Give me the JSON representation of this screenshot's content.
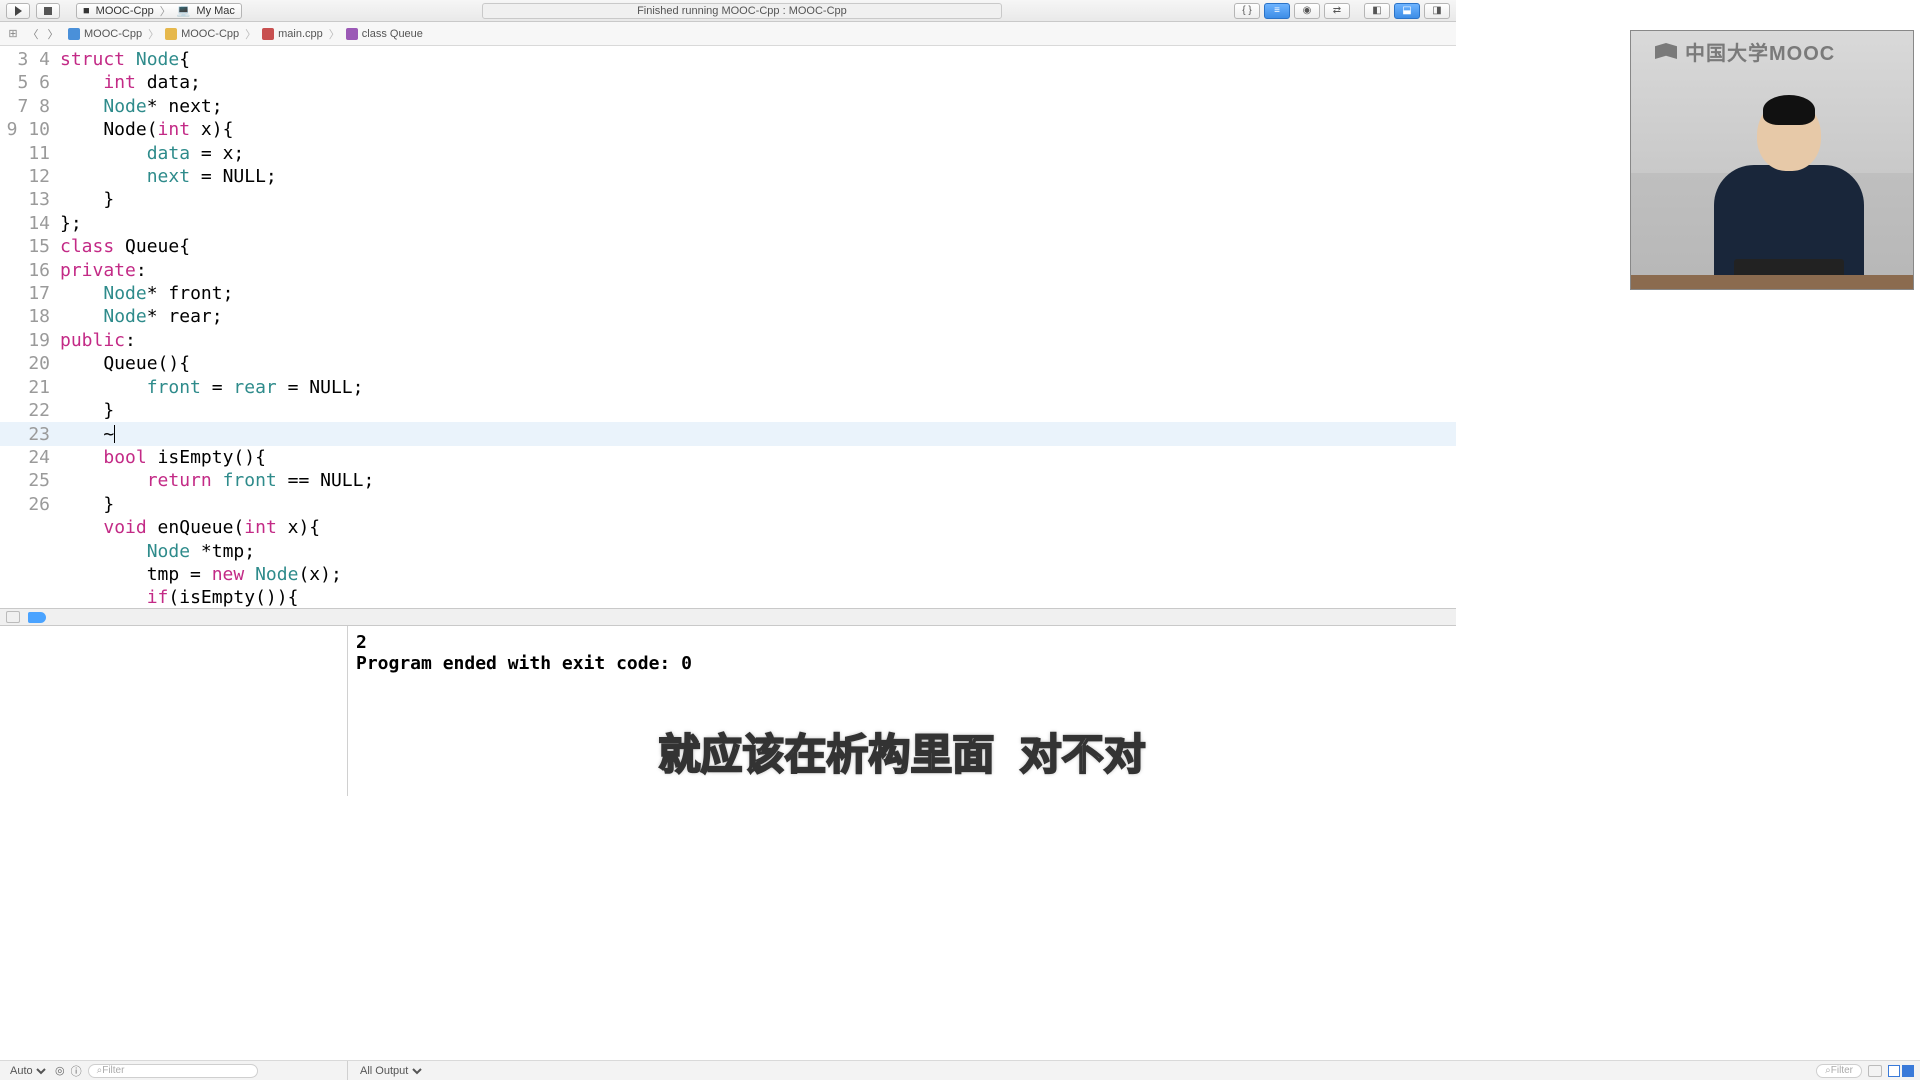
{
  "toolbar": {
    "scheme": "MOOC-Cpp",
    "destination": "My Mac",
    "status": "Finished running MOOC-Cpp : MOOC-Cpp"
  },
  "jumpbar": {
    "items": [
      "MOOC-Cpp",
      "MOOC-Cpp",
      "main.cpp",
      "class Queue"
    ]
  },
  "editor": {
    "first_line_no": 3,
    "highlight_index": 16,
    "lines": [
      [
        [
          "kw",
          "struct"
        ],
        [
          "txt",
          " "
        ],
        [
          "type",
          "Node"
        ],
        [
          "txt",
          "{"
        ]
      ],
      [
        [
          "txt",
          "    "
        ],
        [
          "kw",
          "int"
        ],
        [
          "txt",
          " data;"
        ]
      ],
      [
        [
          "txt",
          "    "
        ],
        [
          "type",
          "Node"
        ],
        [
          "txt",
          "* next;"
        ]
      ],
      [
        [
          "txt",
          "    Node("
        ],
        [
          "kw",
          "int"
        ],
        [
          "txt",
          " x){"
        ]
      ],
      [
        [
          "txt",
          "        "
        ],
        [
          "mem",
          "data"
        ],
        [
          "txt",
          " = x;"
        ]
      ],
      [
        [
          "txt",
          "        "
        ],
        [
          "mem",
          "next"
        ],
        [
          "txt",
          " = NULL;"
        ]
      ],
      [
        [
          "txt",
          "    }"
        ]
      ],
      [
        [
          "txt",
          "};"
        ]
      ],
      [
        [
          "kw",
          "class"
        ],
        [
          "txt",
          " Queue{"
        ]
      ],
      [
        [
          "kw",
          "private"
        ],
        [
          "txt",
          ":"
        ]
      ],
      [
        [
          "txt",
          "    "
        ],
        [
          "type",
          "Node"
        ],
        [
          "txt",
          "* front;"
        ]
      ],
      [
        [
          "txt",
          "    "
        ],
        [
          "type",
          "Node"
        ],
        [
          "txt",
          "* rear;"
        ]
      ],
      [
        [
          "kw",
          "public"
        ],
        [
          "txt",
          ":"
        ]
      ],
      [
        [
          "txt",
          "    Queue(){"
        ]
      ],
      [
        [
          "txt",
          "        "
        ],
        [
          "mem",
          "front"
        ],
        [
          "txt",
          " = "
        ],
        [
          "mem",
          "rear"
        ],
        [
          "txt",
          " = NULL;"
        ]
      ],
      [
        [
          "txt",
          "    }"
        ]
      ],
      [
        [
          "txt",
          "    ~"
        ]
      ],
      [
        [
          "txt",
          "    "
        ],
        [
          "kw",
          "bool"
        ],
        [
          "txt",
          " isEmpty(){"
        ]
      ],
      [
        [
          "txt",
          "        "
        ],
        [
          "kw",
          "return"
        ],
        [
          "txt",
          " "
        ],
        [
          "mem",
          "front"
        ],
        [
          "txt",
          " == NULL;"
        ]
      ],
      [
        [
          "txt",
          "    }"
        ]
      ],
      [
        [
          "txt",
          "    "
        ],
        [
          "kw",
          "void"
        ],
        [
          "txt",
          " enQueue("
        ],
        [
          "kw",
          "int"
        ],
        [
          "txt",
          " x){"
        ]
      ],
      [
        [
          "txt",
          "        "
        ],
        [
          "type",
          "Node"
        ],
        [
          "txt",
          " *tmp;"
        ]
      ],
      [
        [
          "txt",
          "        tmp = "
        ],
        [
          "kw",
          "new"
        ],
        [
          "txt",
          " "
        ],
        [
          "type",
          "Node"
        ],
        [
          "txt",
          "(x);"
        ]
      ],
      [
        [
          "txt",
          "        "
        ],
        [
          "kw",
          "if"
        ],
        [
          "txt",
          "(isEmpty()){"
        ]
      ]
    ]
  },
  "console": {
    "line1": "2",
    "line2": "Program ended with exit code: 0"
  },
  "bottombar": {
    "auto_label": "Auto",
    "filter_placeholder": "Filter",
    "all_output_label": "All Output"
  },
  "subtitle": "就应该在析构里面 对不对",
  "mooc_logo_text": "中国大学MOOC"
}
